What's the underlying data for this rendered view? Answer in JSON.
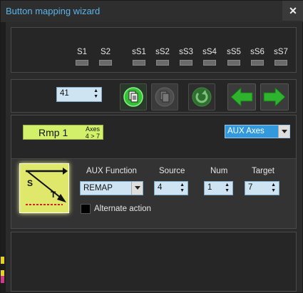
{
  "window": {
    "title": "Button mapping wizard",
    "close_glyph": "✕"
  },
  "slots": [
    "S1",
    "S2",
    "sS1",
    "sS2",
    "sS3",
    "sS4",
    "sS5",
    "sS6",
    "sS7"
  ],
  "toolbar": {
    "button_number": "41",
    "buttons": [
      "copy-icon",
      "paste-icon",
      "reset-icon",
      "previous-arrow-icon",
      "next-arrow-icon"
    ]
  },
  "mapping": {
    "name": "Rmp 1",
    "type_label": "Axes",
    "summary": "4 > 7",
    "type_select": "AUX Axes"
  },
  "aux": {
    "icon": "source-target-diagram-icon",
    "icon_source_letter": "S",
    "icon_target_letter": "T",
    "function_label": "AUX Function",
    "function_value": "REMAP",
    "source_label": "Source",
    "source_value": "4",
    "num_label": "Num",
    "num_value": "1",
    "target_label": "Target",
    "target_value": "7",
    "alternate_label": "Alternate action",
    "alternate_checked": false
  },
  "colors": {
    "title": "#5ab4ea",
    "accent_green": "#2fb32f",
    "chip": "#d2f06a",
    "select": "#cfe4f2"
  }
}
